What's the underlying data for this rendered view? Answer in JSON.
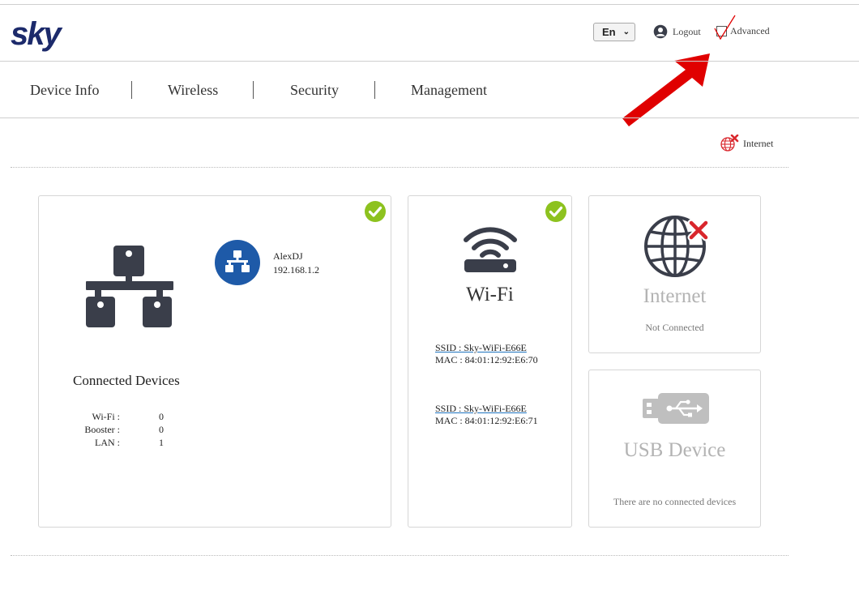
{
  "header": {
    "logo_text": "sky",
    "language": "En",
    "logout_label": "Logout",
    "advanced_label": "Advanced"
  },
  "nav": {
    "items": [
      {
        "label": "Device Info"
      },
      {
        "label": "Wireless"
      },
      {
        "label": "Security"
      },
      {
        "label": "Management"
      }
    ]
  },
  "status_bar": {
    "internet_label": "Internet"
  },
  "connected_card": {
    "device_name": "AlexDJ",
    "device_ip": "192.168.1.2",
    "title": "Connected Devices",
    "stats": [
      {
        "label": "Wi-Fi :",
        "value": "0"
      },
      {
        "label": "Booster :",
        "value": "0"
      },
      {
        "label": "LAN :",
        "value": "1"
      }
    ]
  },
  "wifi_card": {
    "title": "Wi-Fi",
    "networks": [
      {
        "ssid": "SSID : Sky-WiFi-E66E",
        "mac": "MAC : 84:01:12:92:E6:70"
      },
      {
        "ssid": "SSID : Sky-WiFi-E66E",
        "mac": "MAC : 84:01:12:92:E6:71"
      }
    ]
  },
  "internet_card": {
    "title": "Internet",
    "status": "Not Connected"
  },
  "usb_card": {
    "title": "USB Device",
    "status": "There are no connected devices"
  },
  "colors": {
    "logo": "#1c2a6b",
    "check_green": "#8dc21f",
    "error_red": "#d9262c",
    "device_badge_blue": "#1e5aa8",
    "icon_dark": "#3a3e4a",
    "annotation_arrow": "#e00000"
  }
}
